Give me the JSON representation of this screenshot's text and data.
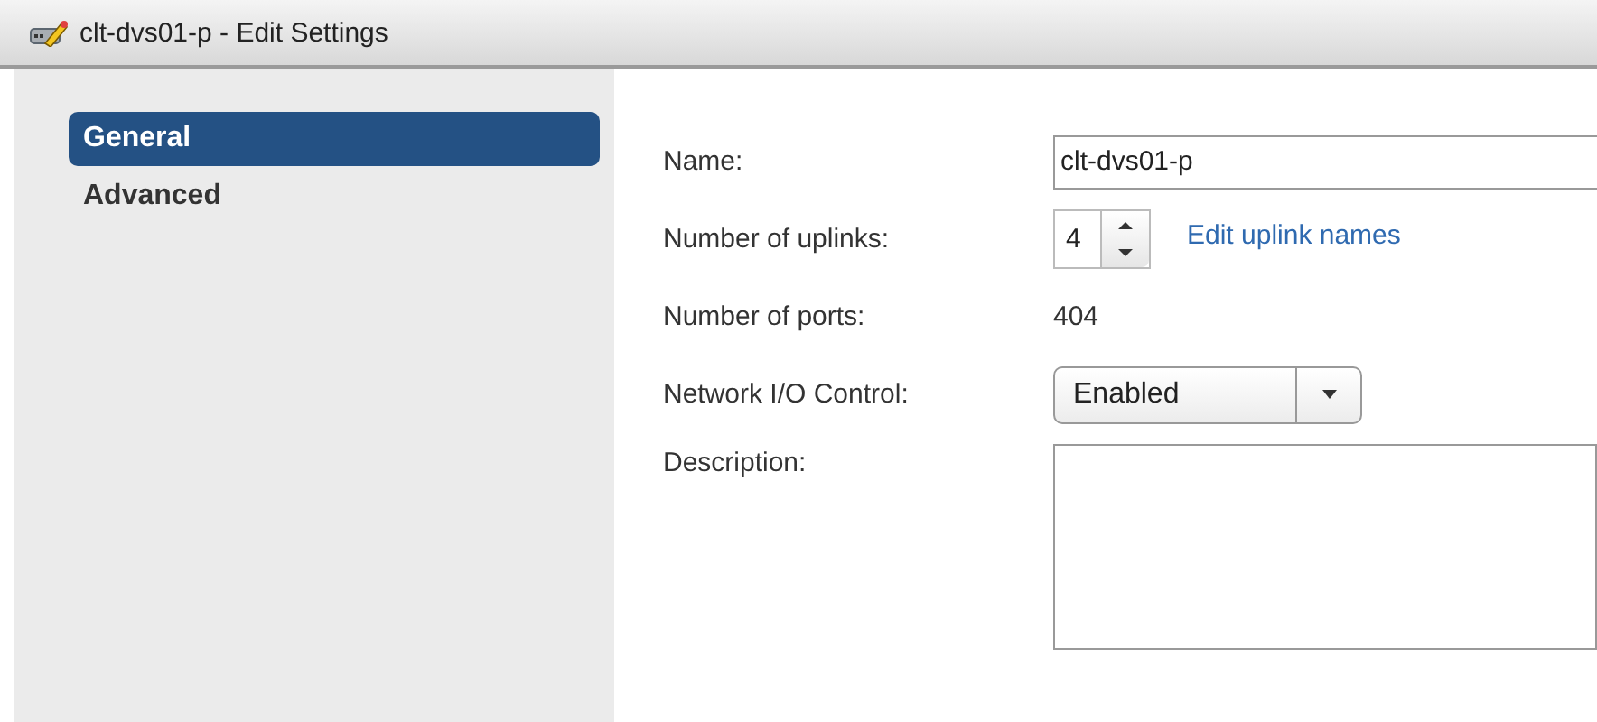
{
  "window": {
    "title": "clt-dvs01-p - Edit Settings"
  },
  "sidebar": {
    "items": [
      {
        "label": "General",
        "selected": true
      },
      {
        "label": "Advanced",
        "selected": false
      }
    ]
  },
  "fields": [
    {
      "kind": "text",
      "label": "Name:",
      "value": "clt-dvs01-p"
    },
    {
      "kind": "spinner",
      "label": "Number of uplinks:",
      "value": "4",
      "link": "Edit uplink names"
    },
    {
      "kind": "static",
      "label": "Number of ports:",
      "value": "404"
    },
    {
      "kind": "dropdown",
      "label": "Network I/O Control:",
      "value": "Enabled"
    },
    {
      "kind": "textarea",
      "label": "Description:"
    }
  ]
}
